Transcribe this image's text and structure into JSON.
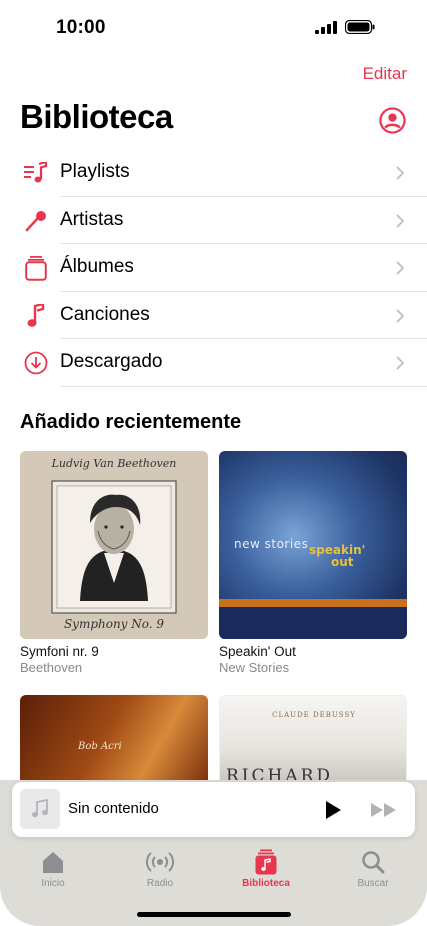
{
  "status": {
    "time": "10:00"
  },
  "header": {
    "edit_label": "Editar",
    "title": "Biblioteca"
  },
  "menu": {
    "items": [
      {
        "label": "Playlists",
        "icon": "playlist-icon"
      },
      {
        "label": "Artistas",
        "icon": "microphone-icon"
      },
      {
        "label": "Álbumes",
        "icon": "album-stack-icon"
      },
      {
        "label": "Canciones",
        "icon": "music-note-icon"
      },
      {
        "label": "Descargado",
        "icon": "download-circle-icon"
      }
    ]
  },
  "recent": {
    "title": "Añadido recientemente",
    "albums": [
      {
        "title": "Symfoni nr. 9",
        "artist": "Beethoven",
        "cover_heading": "Ludvig Van Beethoven",
        "cover_footer": "Symphony No. 9"
      },
      {
        "title": "Speakin' Out",
        "artist": "New Stories",
        "cover_line1": "new stories",
        "cover_line2": "speakin'",
        "cover_line3": "out"
      },
      {
        "title": "",
        "artist": "",
        "cover_line1": "Bob Acri"
      },
      {
        "title": "",
        "artist": "",
        "cover_heading": "CLAUDE DEBUSSY",
        "cover_line1": "RICHARD"
      }
    ]
  },
  "player": {
    "title": "Sin contenido"
  },
  "tabs": [
    {
      "label": "Inicio",
      "icon": "home-icon"
    },
    {
      "label": "Radio",
      "icon": "radio-icon"
    },
    {
      "label": "Biblioteca",
      "icon": "library-icon",
      "active": true
    },
    {
      "label": "Buscar",
      "icon": "search-icon"
    }
  ],
  "colors": {
    "accent": "#e8364f",
    "tab_bar": "#dedcd6",
    "secondary_text": "#8a8a8e"
  }
}
